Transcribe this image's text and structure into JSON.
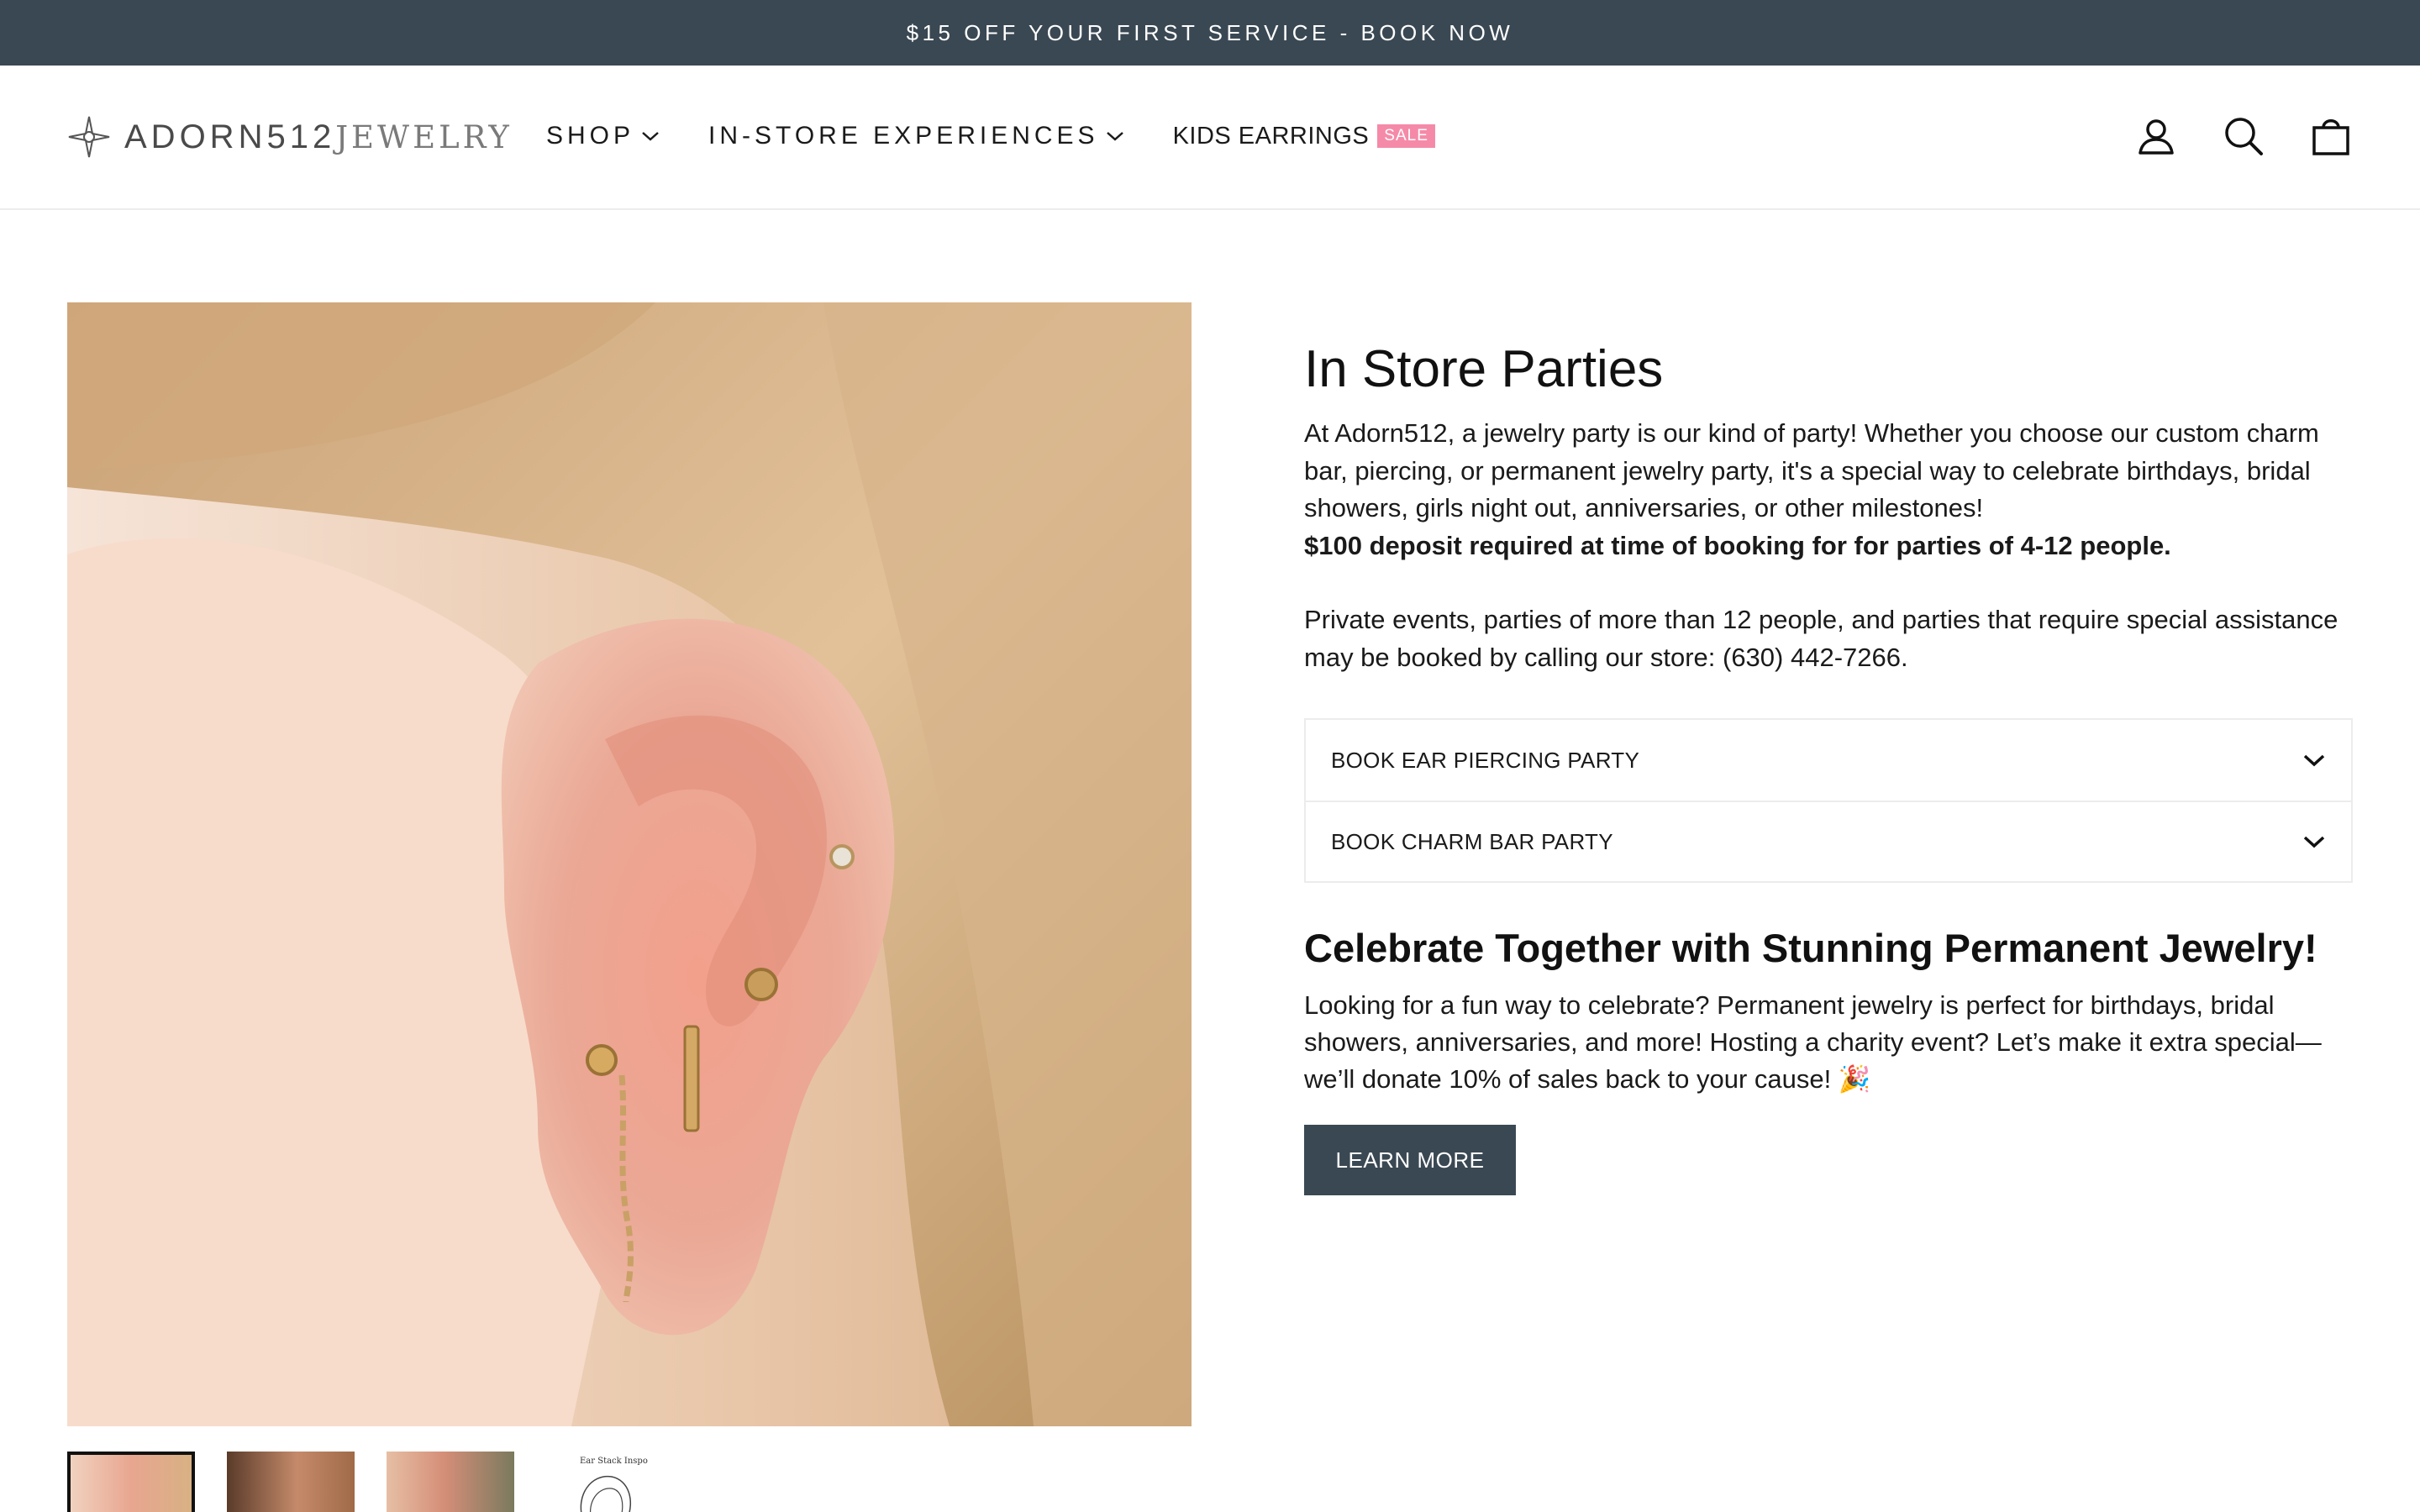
{
  "announcement": {
    "text": "$15 OFF YOUR FIRST SERVICE - BOOK NOW"
  },
  "header": {
    "logo": {
      "part1": "ADORN512",
      "part2": "JEWELRY"
    },
    "nav": [
      {
        "label": "SHOP",
        "has_dropdown": true
      },
      {
        "label": "IN-STORE EXPERIENCES",
        "has_dropdown": true
      },
      {
        "label": "KIDS EARRINGS",
        "badge": "SALE",
        "has_dropdown": false
      }
    ],
    "icons": [
      "account-icon",
      "search-icon",
      "cart-icon"
    ]
  },
  "gallery": {
    "thumbnails": [
      {
        "kind": "photo",
        "active": true
      },
      {
        "kind": "photo",
        "active": false
      },
      {
        "kind": "photo",
        "active": false
      },
      {
        "kind": "illustration",
        "caption": "Ear Stack Inspo",
        "active": false
      }
    ]
  },
  "product": {
    "title": "In Store Parties",
    "intro": "At Adorn512, a jewelry party is our kind of party! Whether you choose our custom charm bar, piercing, or permanent jewelry party, it's a special way to celebrate birthdays, bridal showers, girls night out, anniversaries, or other milestones!",
    "deposit_note": "$100 deposit required at time of booking for for parties of 4-12 people.",
    "private_events": "Private events, parties of more than 12 people, and parties that require special assistance may be booked by calling our store: (630) 442-7266.",
    "accordion": [
      {
        "label": "BOOK EAR PIERCING PARTY"
      },
      {
        "label": "BOOK CHARM BAR PARTY"
      }
    ],
    "subtitle": "Celebrate Together with Stunning Permanent Jewelry!",
    "permanent_text": "Looking for a fun way to celebrate? Permanent jewelry is perfect for birthdays, bridal showers, anniversaries, and more! Hosting a charity event? Let’s make it extra special—we’ll donate 10% of sales back to your cause! 🎉",
    "cta": "LEARN MORE"
  },
  "colors": {
    "announcement_bg": "#3a4853",
    "button_bg": "#3a4853",
    "sale_badge": "#f58aa8"
  }
}
